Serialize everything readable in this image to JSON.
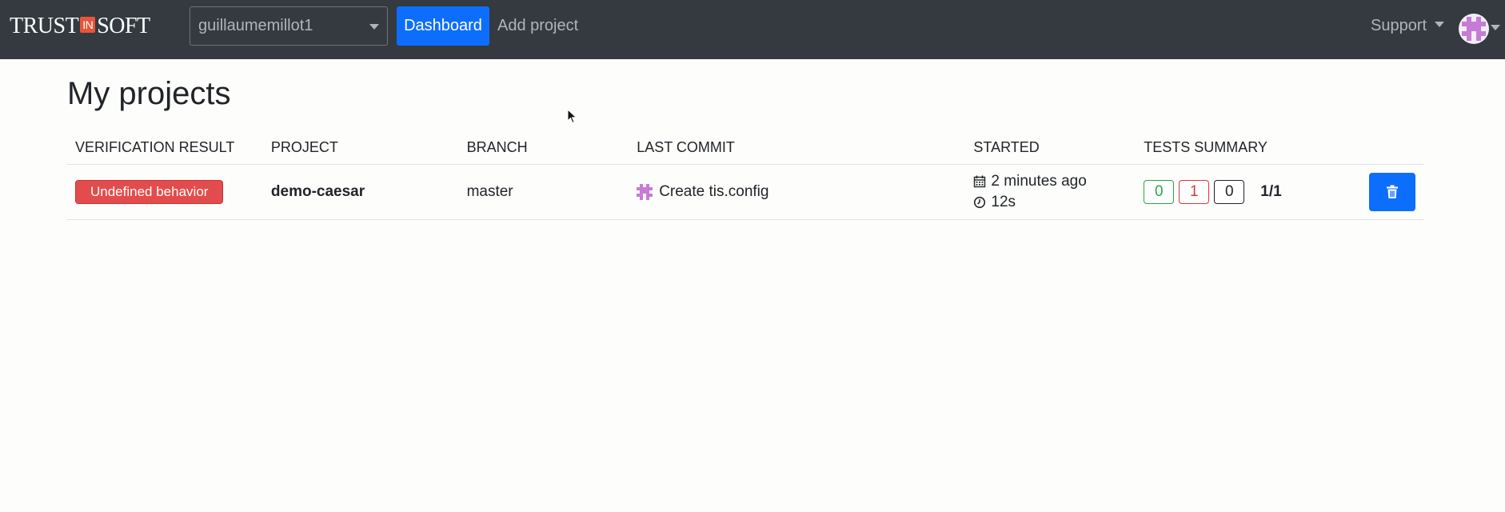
{
  "navbar": {
    "brand": {
      "left": "TRUST",
      "middle": "IN",
      "right": "SOFT"
    },
    "account_select": {
      "value": "guillaumemillot1"
    },
    "dashboard_label": "Dashboard",
    "add_project_label": "Add project",
    "support_label": "Support"
  },
  "page": {
    "title": "My projects"
  },
  "table": {
    "headers": {
      "verification_result": "VERIFICATION RESULT",
      "project": "PROJECT",
      "branch": "BRANCH",
      "last_commit": "LAST COMMIT",
      "started": "STARTED",
      "tests_summary": "TESTS SUMMARY"
    },
    "rows": [
      {
        "verification_result": "Undefined behavior",
        "project": "demo-caesar",
        "branch": "master",
        "last_commit": "Create tis.config",
        "started_ago": "2 minutes ago",
        "duration": "12s",
        "tests_ok": "0",
        "tests_ko": "1",
        "tests_unknown": "0",
        "tests_ratio": "1/1"
      }
    ]
  },
  "colors": {
    "navbar_bg": "#343a40",
    "primary": "#0d6efd",
    "danger": "#e34c4c",
    "success": "#28a745",
    "brand_in": "#e8553a",
    "avatar_pixel": "#c77bd6"
  },
  "icons": {
    "account_caret": "chevron-down-icon",
    "support_caret": "chevron-down-icon",
    "avatar": "identicon-avatar",
    "calendar": "calendar-icon",
    "clock": "clock-icon",
    "delete": "trash-icon",
    "cursor": "mouse-pointer-icon"
  }
}
